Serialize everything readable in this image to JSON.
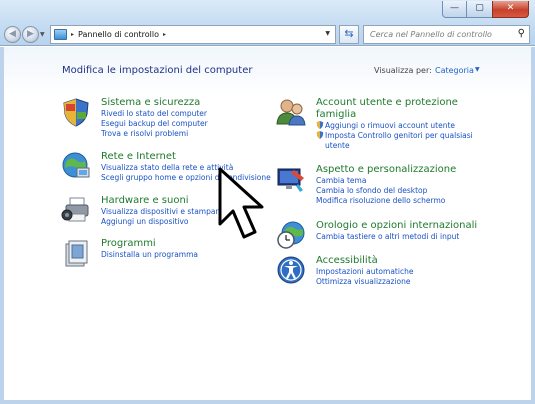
{
  "window": {
    "buttons": {
      "minimize": "—",
      "maximize": "▢",
      "close": "✕"
    }
  },
  "toolbar": {
    "back_icon": "back-arrow-icon",
    "forward_icon": "forward-arrow-icon",
    "address": {
      "path": [
        "Pannello di controllo"
      ],
      "separator": "▸"
    },
    "refresh_icon": "refresh-icon",
    "search": {
      "placeholder": "Cerca nel Pannello di controllo",
      "icon": "search-icon"
    }
  },
  "main": {
    "title": "Modifica le impostazioni del computer",
    "view_by_label": "Visualizza per:",
    "view_by_value": "Categoria"
  },
  "categories": {
    "system": {
      "title": "Sistema e sicurezza",
      "links": [
        "Rivedi lo stato del computer",
        "Esegui backup del computer",
        "Trova e risolvi problemi"
      ]
    },
    "network": {
      "title": "Rete e Internet",
      "links": [
        "Visualizza stato della rete e attività",
        "Scegli gruppo home e opzioni di condivisione"
      ]
    },
    "hardware": {
      "title": "Hardware e suoni",
      "links": [
        "Visualizza dispositivi e stampanti",
        "Aggiungi un dispositivo"
      ]
    },
    "programs": {
      "title": "Programmi",
      "links": [
        "Disinstalla un programma"
      ]
    },
    "accounts": {
      "title_line1": "Account utente e protezione",
      "title_line2": "famiglia",
      "links": [
        "Aggiungi o rimuovi account utente",
        "Imposta Controllo genitori per qualsiasi",
        "utente"
      ]
    },
    "appearance": {
      "title": "Aspetto e personalizzazione",
      "links": [
        "Cambia tema",
        "Cambia lo sfondo del desktop",
        "Modifica risoluzione dello schermo"
      ]
    },
    "clock": {
      "title": "Orologio e opzioni internazionali",
      "links": [
        "Cambia tastiere o altri metodi di input"
      ]
    },
    "access": {
      "title": "Accessibilità",
      "links": [
        "Impostazioni automatiche",
        "Ottimizza visualizzazione"
      ]
    }
  },
  "colors": {
    "link": "#1a52c4",
    "category_title": "#1e7a2c",
    "page_title": "#1e3287"
  }
}
